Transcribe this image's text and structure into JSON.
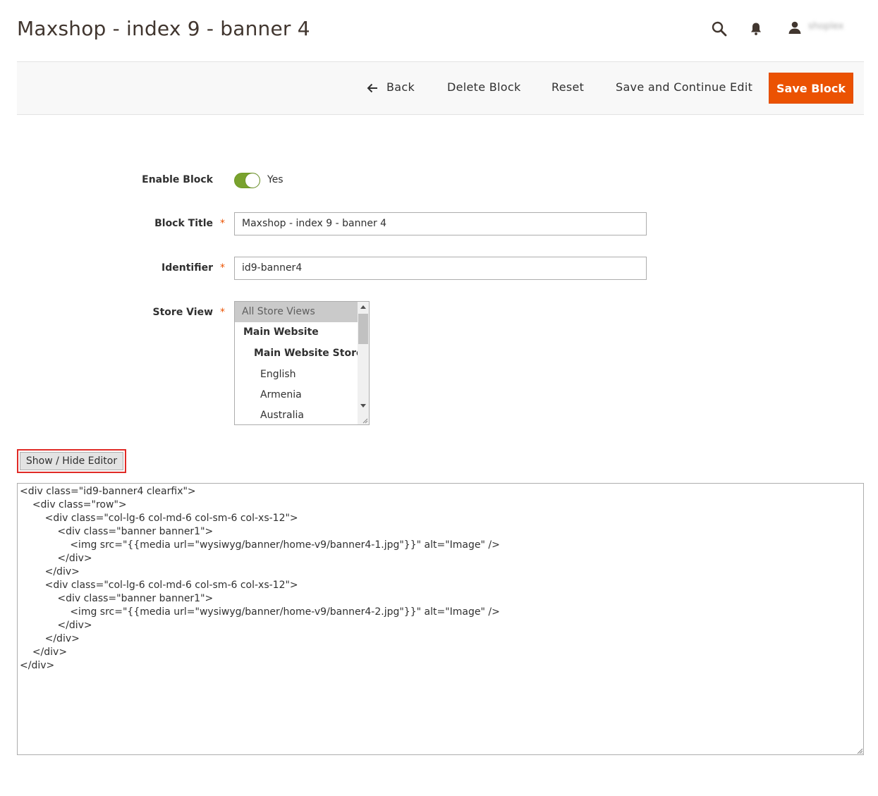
{
  "header": {
    "title": "Maxshop - index 9 - banner 4",
    "user_name": "shoplex"
  },
  "actions": {
    "back": "Back",
    "delete": "Delete Block",
    "reset": "Reset",
    "save_continue": "Save and Continue Edit",
    "save": "Save Block"
  },
  "form": {
    "enable": {
      "label": "Enable Block",
      "value": "Yes",
      "checked": true
    },
    "title": {
      "label": "Block Title",
      "value": "Maxshop - index 9 - banner 4",
      "required_mark": "*"
    },
    "identifier": {
      "label": "Identifier",
      "value": "id9-banner4",
      "required_mark": "*"
    },
    "store_view": {
      "label": "Store View",
      "required_mark": "*",
      "options": [
        {
          "label": "All Store Views",
          "selected": true
        },
        {
          "label": "Main Website",
          "selected": false
        },
        {
          "label": "Main Website Store",
          "selected": false
        },
        {
          "label": "English",
          "selected": false
        },
        {
          "label": "Armenia",
          "selected": false
        },
        {
          "label": "Australia",
          "selected": false
        }
      ]
    }
  },
  "editor": {
    "toggle_label": "Show / Hide Editor",
    "content": "<div class=\"id9-banner4 clearfix\">\n\t<div class=\"row\">\n\t\t<div class=\"col-lg-6 col-md-6 col-sm-6 col-xs-12\">\n\t\t\t<div class=\"banner banner1\">\n\t\t\t\t<img src=\"{{media url=\"wysiwyg/banner/home-v9/banner4-1.jpg\"}}\" alt=\"Image\" />\n\t\t\t</div>\n\t\t</div>\n\t\t<div class=\"col-lg-6 col-md-6 col-sm-6 col-xs-12\">\n\t\t\t<div class=\"banner banner1\">\n\t\t\t\t<img src=\"{{media url=\"wysiwyg/banner/home-v9/banner4-2.jpg\"}}\" alt=\"Image\" />\n\t\t\t</div>\n\t\t</div>\n\t</div>\n</div>"
  },
  "colors": {
    "accent": "#eb5202",
    "toggle_on": "#79a22e",
    "highlight_border": "#e02b27"
  }
}
